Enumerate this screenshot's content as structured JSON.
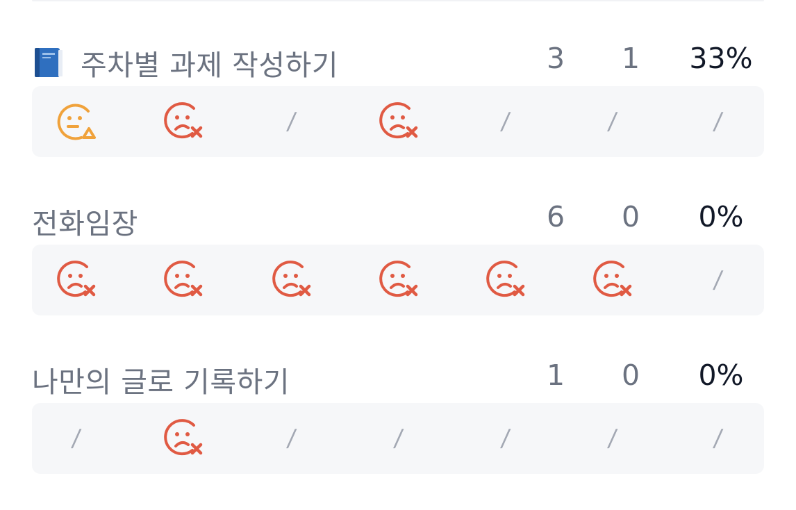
{
  "sections": [
    {
      "title": "주차별 과제 작성하기",
      "icon": "blue-book-icon",
      "total": "3",
      "done": "1",
      "percent": "33%",
      "cells": [
        "partial-face-icon",
        "sad-face-x-icon",
        "/",
        "sad-face-x-icon",
        "/",
        "/",
        "/"
      ]
    },
    {
      "title": "전화임장",
      "icon": null,
      "total": "6",
      "done": "0",
      "percent": "0%",
      "cells": [
        "sad-face-x-icon",
        "sad-face-x-icon",
        "sad-face-x-icon",
        "sad-face-x-icon",
        "sad-face-x-icon",
        "sad-face-x-icon",
        "/"
      ]
    },
    {
      "title": "나만의 글로 기록하기",
      "icon": null,
      "total": "1",
      "done": "0",
      "percent": "0%",
      "cells": [
        "/",
        "sad-face-x-icon",
        "/",
        "/",
        "/",
        "/",
        "/"
      ]
    }
  ],
  "colors": {
    "fail": "#e05a43",
    "partial": "#f0a23b",
    "empty": "#a3a8b3",
    "cell_bg": "#f6f7f9",
    "title": "#6b7280",
    "percent": "#111827"
  }
}
